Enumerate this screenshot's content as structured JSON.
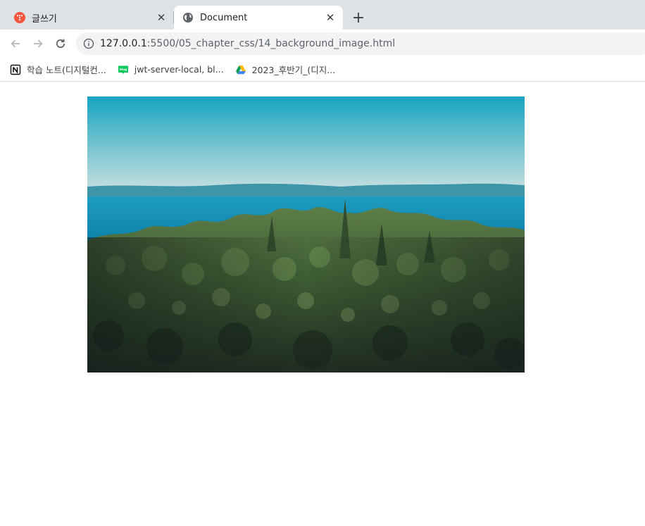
{
  "tabs": [
    {
      "title": "글쓰기",
      "icon": "tistory-icon",
      "active": false
    },
    {
      "title": "Document",
      "icon": "globe-icon",
      "active": true
    }
  ],
  "toolbar": {
    "url_host": "127.0.0.1",
    "url_rest": ":5500/05_chapter_css/14_background_image.html"
  },
  "bookmarks": [
    {
      "label": "학습 노트(디지털컨...",
      "icon": "notion-icon"
    },
    {
      "label": "jwt-server-local, bl...",
      "icon": "naver-blog-icon"
    },
    {
      "label": "2023_후반기_(디지...",
      "icon": "google-drive-icon"
    }
  ],
  "colors": {
    "tab_strip": "#dee1e6",
    "omnibox": "#f1f3f4",
    "sky": "#4fb8cc",
    "sea": "#1a8fb4",
    "forest": "#3a5a2e"
  },
  "content": {
    "background_image": "forest-and-sea-photo"
  }
}
